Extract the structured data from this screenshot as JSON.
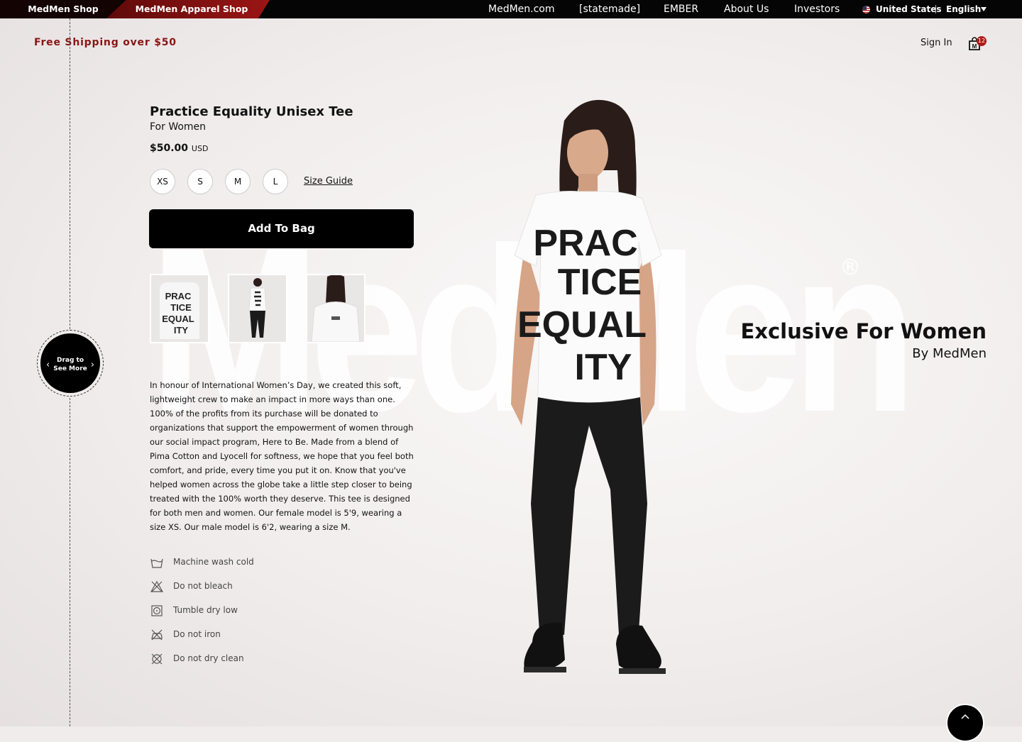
{
  "topbar": {
    "shop_tabs": [
      "MedMen Shop",
      "MedMen Apparel Shop"
    ],
    "nav": [
      "MedMen.com",
      "[statemade]",
      "EMBER",
      "About Us",
      "Investors"
    ],
    "country": "United States",
    "language": "English"
  },
  "header": {
    "promo": "Free Shipping over $50",
    "sign_in": "Sign In",
    "bag_count": "12"
  },
  "drag": {
    "line1": "Drag to",
    "line2": "See More"
  },
  "watermark": {
    "text": "MedMen",
    "mark": "®"
  },
  "product": {
    "title": "Practice Equality Unisex Tee",
    "subtitle": "For Women",
    "price": "$50.00",
    "currency": "USD",
    "sizes": [
      "XS",
      "S",
      "M",
      "L"
    ],
    "size_guide": "Size Guide",
    "add_to_bag": "Add To Bag",
    "shirt_text": [
      "PRAC",
      "TICE",
      "EQUAL",
      "ITY"
    ],
    "description": "In honour of International Women’s Day, we created this soft, lightweight crew to make an impact in more ways than one. 100% of the profits from its purchase will be donated to organizations that support the empowerment of women through our social impact program, Here to Be. Made from a blend of Pima Cotton and Lyocell for softness, we hope that you feel both comfort, and pride, every time you put it on. Know that you've helped women across the globe take a little step closer to being treated with the 100% worth they deserve. This tee is designed for both men and women. Our female model is 5'9, wearing a size XS. Our male model is 6'2, wearing a size M.",
    "care": [
      {
        "icon": "wash-icon",
        "label": "Machine wash cold"
      },
      {
        "icon": "no-bleach-icon",
        "label": "Do not bleach"
      },
      {
        "icon": "tumble-dry-icon",
        "label": "Tumble dry low"
      },
      {
        "icon": "no-iron-icon",
        "label": "Do not iron"
      },
      {
        "icon": "no-dry-clean-icon",
        "label": "Do not dry clean"
      }
    ]
  },
  "hero": {
    "title": "Exclusive For Women",
    "subtitle": "By MedMen"
  },
  "colors": {
    "accent": "#8a1515",
    "badge": "#b01818",
    "button": "#000000"
  }
}
